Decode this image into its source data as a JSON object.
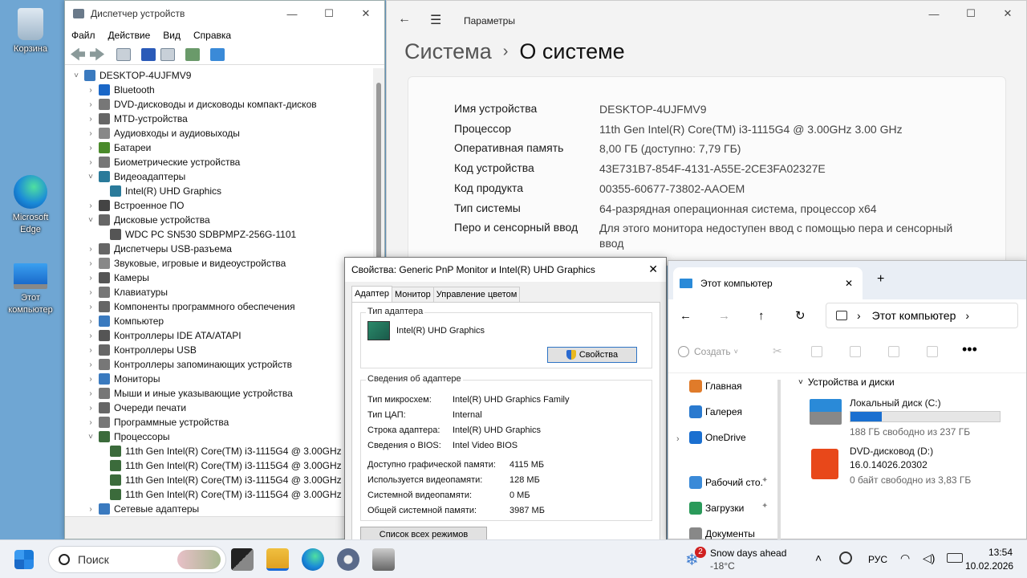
{
  "desktop": {
    "icons": [
      {
        "label": "Корзина"
      },
      {
        "label": "Microsoft Edge"
      },
      {
        "label": "Этот компьютер"
      }
    ]
  },
  "device_manager": {
    "title": "Диспетчер устройств",
    "menu": [
      "Файл",
      "Действие",
      "Вид",
      "Справка"
    ],
    "root": "DESKTOP-4UJFMV9",
    "tree": [
      {
        "label": "Bluetooth",
        "level": 1,
        "exp": "›",
        "color": "#1a67c7"
      },
      {
        "label": "DVD-дисководы и дисководы компакт-дисков",
        "level": 1,
        "exp": "›",
        "color": "#777"
      },
      {
        "label": "MTD-устройства",
        "level": 1,
        "exp": "›",
        "color": "#666"
      },
      {
        "label": "Аудиовходы и аудиовыходы",
        "level": 1,
        "exp": "›",
        "color": "#888"
      },
      {
        "label": "Батареи",
        "level": 1,
        "exp": "›",
        "color": "#4a8a2a"
      },
      {
        "label": "Биометрические устройства",
        "level": 1,
        "exp": "›",
        "color": "#777"
      },
      {
        "label": "Видеоадаптеры",
        "level": 1,
        "exp": "˅",
        "color": "#2a7a9a"
      },
      {
        "label": "Intel(R) UHD Graphics",
        "level": 2,
        "exp": "",
        "color": "#2a7a9a"
      },
      {
        "label": "Встроенное ПО",
        "level": 1,
        "exp": "›",
        "color": "#444"
      },
      {
        "label": "Дисковые устройства",
        "level": 1,
        "exp": "˅",
        "color": "#666"
      },
      {
        "label": "WDC PC SN530 SDBPMPZ-256G-1101",
        "level": 2,
        "exp": "",
        "color": "#555"
      },
      {
        "label": "Диспетчеры USB-разъема",
        "level": 1,
        "exp": "›",
        "color": "#666"
      },
      {
        "label": "Звуковые, игровые и видеоустройства",
        "level": 1,
        "exp": "›",
        "color": "#888"
      },
      {
        "label": "Камеры",
        "level": 1,
        "exp": "›",
        "color": "#555"
      },
      {
        "label": "Клавиатуры",
        "level": 1,
        "exp": "›",
        "color": "#777"
      },
      {
        "label": "Компоненты программного обеспечения",
        "level": 1,
        "exp": "›",
        "color": "#666"
      },
      {
        "label": "Компьютер",
        "level": 1,
        "exp": "›",
        "color": "#3a7abf"
      },
      {
        "label": "Контроллеры IDE ATA/ATAPI",
        "level": 1,
        "exp": "›",
        "color": "#555"
      },
      {
        "label": "Контроллеры USB",
        "level": 1,
        "exp": "›",
        "color": "#666"
      },
      {
        "label": "Контроллеры запоминающих устройств",
        "level": 1,
        "exp": "›",
        "color": "#777"
      },
      {
        "label": "Мониторы",
        "level": 1,
        "exp": "›",
        "color": "#3a7abf"
      },
      {
        "label": "Мыши и иные указывающие устройства",
        "level": 1,
        "exp": "›",
        "color": "#777"
      },
      {
        "label": "Очереди печати",
        "level": 1,
        "exp": "›",
        "color": "#666"
      },
      {
        "label": "Программные устройства",
        "level": 1,
        "exp": "›",
        "color": "#777"
      },
      {
        "label": "Процессоры",
        "level": 1,
        "exp": "˅",
        "color": "#3b6b3b"
      },
      {
        "label": "11th Gen Intel(R) Core(TM) i3-1115G4 @ 3.00GHz",
        "level": 2,
        "exp": "",
        "color": "#3b6b3b"
      },
      {
        "label": "11th Gen Intel(R) Core(TM) i3-1115G4 @ 3.00GHz",
        "level": 2,
        "exp": "",
        "color": "#3b6b3b"
      },
      {
        "label": "11th Gen Intel(R) Core(TM) i3-1115G4 @ 3.00GHz",
        "level": 2,
        "exp": "",
        "color": "#3b6b3b"
      },
      {
        "label": "11th Gen Intel(R) Core(TM) i3-1115G4 @ 3.00GHz",
        "level": 2,
        "exp": "",
        "color": "#3b6b3b"
      },
      {
        "label": "Сетевые адаптеры",
        "level": 1,
        "exp": "›",
        "color": "#3a7abf"
      }
    ]
  },
  "settings": {
    "title": "Параметры",
    "breadcrumb_parent": "Система",
    "breadcrumb_sep": "›",
    "page_title": "О системе",
    "specs": [
      {
        "k": "Имя устройства",
        "v": "DESKTOP-4UJFMV9"
      },
      {
        "k": "Процессор",
        "v": "11th Gen Intel(R) Core(TM) i3-1115G4 @ 3.00GHz   3.00 GHz"
      },
      {
        "k": "Оперативная память",
        "v": "8,00 ГБ (доступно: 7,79 ГБ)"
      },
      {
        "k": "Код устройства",
        "v": "43E731B7-854F-4131-A55E-2CE3FA02327E"
      },
      {
        "k": "Код продукта",
        "v": "00355-60677-73802-AAOEM"
      },
      {
        "k": "Тип системы",
        "v": "64-разрядная операционная система, процессор x64"
      },
      {
        "k": "Перо и сенсорный ввод",
        "v": "Для этого монитора недоступен ввод с помощью пера и сенсорный ввод"
      }
    ]
  },
  "properties": {
    "title": "Свойства: Generic PnP Monitor и Intel(R) UHD Graphics",
    "tabs": [
      "Адаптер",
      "Монитор",
      "Управление цветом"
    ],
    "adapter_type_label": "Тип адаптера",
    "adapter_name": "Intel(R) UHD Graphics",
    "properties_button": "Свойства",
    "info_label": "Сведения об адаптере",
    "info": [
      {
        "k": "Тип микросхем:",
        "v": "Intel(R) UHD Graphics Family"
      },
      {
        "k": "Тип ЦАП:",
        "v": "Internal"
      },
      {
        "k": "Строка адаптера:",
        "v": "Intel(R) UHD Graphics"
      },
      {
        "k": "Сведения о BIOS:",
        "v": "Intel Video BIOS"
      }
    ],
    "memory": [
      {
        "k": "Доступно графической памяти:",
        "v": "4115 МБ"
      },
      {
        "k": "Используется видеопамяти:",
        "v": "128 МБ"
      },
      {
        "k": "Системной видеопамяти:",
        "v": "0 МБ"
      },
      {
        "k": "Общей системной памяти:",
        "v": "3987 МБ"
      }
    ],
    "list_modes_button": "Список всех режимов"
  },
  "explorer": {
    "tab_title": "Этот компьютер",
    "address": "Этот компьютер",
    "create_label": "Создать",
    "sidebar": [
      {
        "label": "Главная",
        "color": "#e07b2a"
      },
      {
        "label": "Галерея",
        "color": "#2a7acf"
      },
      {
        "label": "OneDrive",
        "color": "#1a6fd0"
      },
      {
        "label": "Рабочий сто.",
        "color": "#3a8ad8"
      },
      {
        "label": "Загрузки",
        "color": "#2a9a5a"
      },
      {
        "label": "Документы",
        "color": "#888"
      }
    ],
    "section": "Устройства и диски",
    "drives": [
      {
        "name": "Локальный диск (C:)",
        "free": "188 ГБ свободно из 237 ГБ",
        "used_fraction": 0.21
      },
      {
        "name": "DVD-дисковод (D:)",
        "sub": "16.0.14026.20302",
        "free": "0 байт свободно из 3,83 ГБ"
      }
    ]
  },
  "taskbar": {
    "search_placeholder": "Поиск",
    "weather_title": "Snow days ahead",
    "weather_temp": "-18°C",
    "weather_badge": "2",
    "lang": "РУС",
    "time": "13:54",
    "date": "10.02.2026"
  }
}
